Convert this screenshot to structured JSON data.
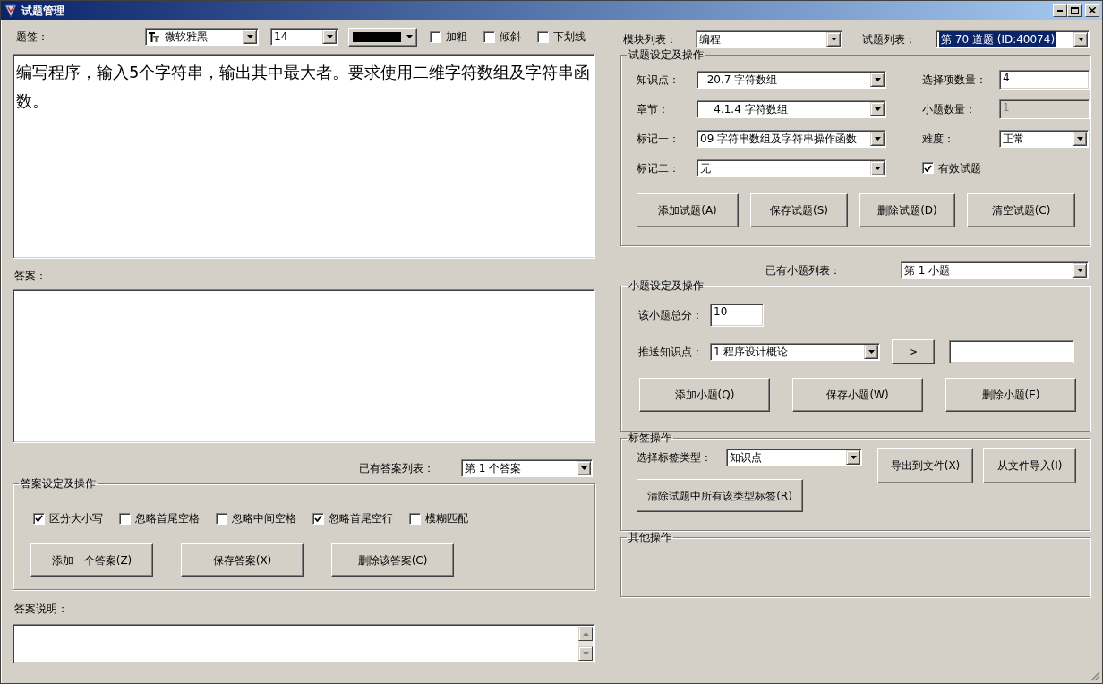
{
  "window": {
    "title": "试题管理"
  },
  "format_bar": {
    "label": "题签：",
    "font": "微软雅黑",
    "size": "14",
    "color": "#000000",
    "options": [
      {
        "label": "加粗",
        "checked": false
      },
      {
        "label": "倾斜",
        "checked": false
      },
      {
        "label": "下划线",
        "checked": false
      }
    ]
  },
  "question_text": "编写程序，输入5个字符串，输出其中最大者。要求使用二维字符数组及字符串函数。",
  "answer_label": "答案：",
  "answer_list": {
    "label": "已有答案列表：",
    "value": "第 1 个答案"
  },
  "answer_settings": {
    "title": "答案设定及操作",
    "options": [
      {
        "label": "区分大小写",
        "checked": true
      },
      {
        "label": "忽略首尾空格",
        "checked": false
      },
      {
        "label": "忽略中间空格",
        "checked": false
      },
      {
        "label": "忽略首尾空行",
        "checked": true
      },
      {
        "label": "模糊匹配",
        "checked": false
      }
    ],
    "buttons": [
      "添加一个答案(Z)",
      "保存答案(X)",
      "删除该答案(C)"
    ]
  },
  "answer_note": {
    "label": "答案说明："
  },
  "module_list": {
    "label": "模块列表：",
    "value": "编程"
  },
  "question_list": {
    "label": "试题列表：",
    "value": "第 70 道题 (ID:40074)",
    "highlighted": true
  },
  "question_settings": {
    "title": "试题设定及操作",
    "left_fields": [
      {
        "label": "知识点：",
        "value": "  20.7 字符数组"
      },
      {
        "label": "章节：",
        "value": "    4.1.4 字符数组"
      },
      {
        "label": "标记一：",
        "value": "09 字符串数组及字符串操作函数"
      },
      {
        "label": "标记二：",
        "value": "无"
      }
    ],
    "right_fields": [
      {
        "kind": "input",
        "label": "选择项数量：",
        "value": "4",
        "disabled": false
      },
      {
        "kind": "input",
        "label": "小题数量：",
        "value": "1",
        "disabled": true
      },
      {
        "kind": "dropdown",
        "label": "难度：",
        "value": "正常"
      },
      {
        "kind": "checkbox",
        "label": "有效试题",
        "checked": true
      }
    ],
    "buttons": [
      "添加试题(A)",
      "保存试题(S)",
      "删除试题(D)",
      "清空试题(C)"
    ]
  },
  "subquestion_list": {
    "label": "已有小题列表：",
    "value": "第 1 小题"
  },
  "subquestion_settings": {
    "title": "小题设定及操作",
    "score_label": "该小题总分：",
    "score": "10",
    "push_label": "推送知识点：",
    "push_value": "1 程序设计概论",
    "push_button": ">",
    "buttons": [
      "添加小题(Q)",
      "保存小题(W)",
      "删除小题(E)"
    ]
  },
  "tag_ops": {
    "title": "标签操作",
    "type_label": "选择标签类型：",
    "type_value": "知识点",
    "buttons": [
      "导出到文件(X)",
      "从文件导入(I)"
    ],
    "clear_button": "清除试题中所有该类型标签(R)"
  },
  "other_ops": {
    "title": "其他操作"
  }
}
